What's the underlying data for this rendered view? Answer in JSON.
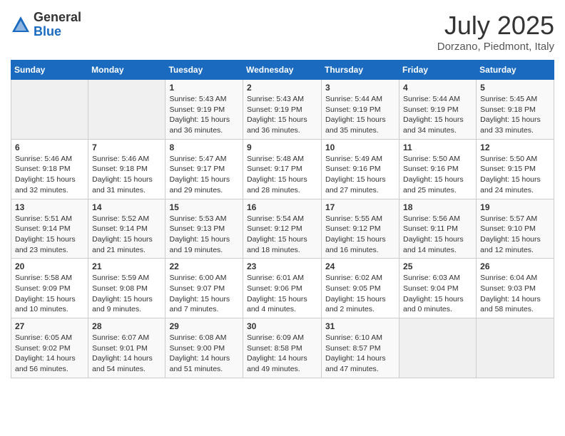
{
  "header": {
    "logo_general": "General",
    "logo_blue": "Blue",
    "title": "July 2025",
    "location": "Dorzano, Piedmont, Italy"
  },
  "weekdays": [
    "Sunday",
    "Monday",
    "Tuesday",
    "Wednesday",
    "Thursday",
    "Friday",
    "Saturday"
  ],
  "weeks": [
    [
      {
        "day": "",
        "detail": ""
      },
      {
        "day": "",
        "detail": ""
      },
      {
        "day": "1",
        "detail": "Sunrise: 5:43 AM\nSunset: 9:19 PM\nDaylight: 15 hours\nand 36 minutes."
      },
      {
        "day": "2",
        "detail": "Sunrise: 5:43 AM\nSunset: 9:19 PM\nDaylight: 15 hours\nand 36 minutes."
      },
      {
        "day": "3",
        "detail": "Sunrise: 5:44 AM\nSunset: 9:19 PM\nDaylight: 15 hours\nand 35 minutes."
      },
      {
        "day": "4",
        "detail": "Sunrise: 5:44 AM\nSunset: 9:19 PM\nDaylight: 15 hours\nand 34 minutes."
      },
      {
        "day": "5",
        "detail": "Sunrise: 5:45 AM\nSunset: 9:18 PM\nDaylight: 15 hours\nand 33 minutes."
      }
    ],
    [
      {
        "day": "6",
        "detail": "Sunrise: 5:46 AM\nSunset: 9:18 PM\nDaylight: 15 hours\nand 32 minutes."
      },
      {
        "day": "7",
        "detail": "Sunrise: 5:46 AM\nSunset: 9:18 PM\nDaylight: 15 hours\nand 31 minutes."
      },
      {
        "day": "8",
        "detail": "Sunrise: 5:47 AM\nSunset: 9:17 PM\nDaylight: 15 hours\nand 29 minutes."
      },
      {
        "day": "9",
        "detail": "Sunrise: 5:48 AM\nSunset: 9:17 PM\nDaylight: 15 hours\nand 28 minutes."
      },
      {
        "day": "10",
        "detail": "Sunrise: 5:49 AM\nSunset: 9:16 PM\nDaylight: 15 hours\nand 27 minutes."
      },
      {
        "day": "11",
        "detail": "Sunrise: 5:50 AM\nSunset: 9:16 PM\nDaylight: 15 hours\nand 25 minutes."
      },
      {
        "day": "12",
        "detail": "Sunrise: 5:50 AM\nSunset: 9:15 PM\nDaylight: 15 hours\nand 24 minutes."
      }
    ],
    [
      {
        "day": "13",
        "detail": "Sunrise: 5:51 AM\nSunset: 9:14 PM\nDaylight: 15 hours\nand 23 minutes."
      },
      {
        "day": "14",
        "detail": "Sunrise: 5:52 AM\nSunset: 9:14 PM\nDaylight: 15 hours\nand 21 minutes."
      },
      {
        "day": "15",
        "detail": "Sunrise: 5:53 AM\nSunset: 9:13 PM\nDaylight: 15 hours\nand 19 minutes."
      },
      {
        "day": "16",
        "detail": "Sunrise: 5:54 AM\nSunset: 9:12 PM\nDaylight: 15 hours\nand 18 minutes."
      },
      {
        "day": "17",
        "detail": "Sunrise: 5:55 AM\nSunset: 9:12 PM\nDaylight: 15 hours\nand 16 minutes."
      },
      {
        "day": "18",
        "detail": "Sunrise: 5:56 AM\nSunset: 9:11 PM\nDaylight: 15 hours\nand 14 minutes."
      },
      {
        "day": "19",
        "detail": "Sunrise: 5:57 AM\nSunset: 9:10 PM\nDaylight: 15 hours\nand 12 minutes."
      }
    ],
    [
      {
        "day": "20",
        "detail": "Sunrise: 5:58 AM\nSunset: 9:09 PM\nDaylight: 15 hours\nand 10 minutes."
      },
      {
        "day": "21",
        "detail": "Sunrise: 5:59 AM\nSunset: 9:08 PM\nDaylight: 15 hours\nand 9 minutes."
      },
      {
        "day": "22",
        "detail": "Sunrise: 6:00 AM\nSunset: 9:07 PM\nDaylight: 15 hours\nand 7 minutes."
      },
      {
        "day": "23",
        "detail": "Sunrise: 6:01 AM\nSunset: 9:06 PM\nDaylight: 15 hours\nand 4 minutes."
      },
      {
        "day": "24",
        "detail": "Sunrise: 6:02 AM\nSunset: 9:05 PM\nDaylight: 15 hours\nand 2 minutes."
      },
      {
        "day": "25",
        "detail": "Sunrise: 6:03 AM\nSunset: 9:04 PM\nDaylight: 15 hours\nand 0 minutes."
      },
      {
        "day": "26",
        "detail": "Sunrise: 6:04 AM\nSunset: 9:03 PM\nDaylight: 14 hours\nand 58 minutes."
      }
    ],
    [
      {
        "day": "27",
        "detail": "Sunrise: 6:05 AM\nSunset: 9:02 PM\nDaylight: 14 hours\nand 56 minutes."
      },
      {
        "day": "28",
        "detail": "Sunrise: 6:07 AM\nSunset: 9:01 PM\nDaylight: 14 hours\nand 54 minutes."
      },
      {
        "day": "29",
        "detail": "Sunrise: 6:08 AM\nSunset: 9:00 PM\nDaylight: 14 hours\nand 51 minutes."
      },
      {
        "day": "30",
        "detail": "Sunrise: 6:09 AM\nSunset: 8:58 PM\nDaylight: 14 hours\nand 49 minutes."
      },
      {
        "day": "31",
        "detail": "Sunrise: 6:10 AM\nSunset: 8:57 PM\nDaylight: 14 hours\nand 47 minutes."
      },
      {
        "day": "",
        "detail": ""
      },
      {
        "day": "",
        "detail": ""
      }
    ]
  ]
}
